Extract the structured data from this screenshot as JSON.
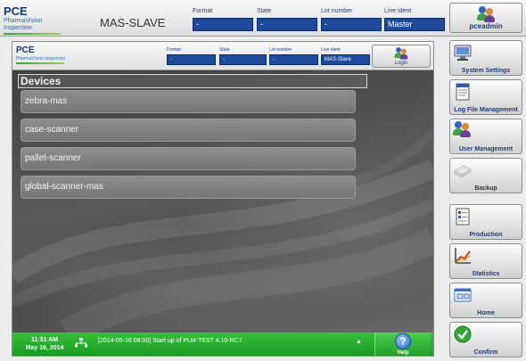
{
  "header": {
    "brand": "PCE",
    "brand_sub": "PharmaVision Inspection",
    "title": "MAS-SLAVE",
    "fields": [
      {
        "label": "Format",
        "value": "-"
      },
      {
        "label": "State",
        "value": "-"
      },
      {
        "label": "Lot number",
        "value": "-"
      },
      {
        "label": "Line ident",
        "value": "Master"
      }
    ],
    "user_button_label": "pceadmin"
  },
  "panel": {
    "header": {
      "brand": "PCE",
      "brand_sub": "PharmaVision Inspection",
      "fields": [
        {
          "label": "Format",
          "value": "-"
        },
        {
          "label": "State",
          "value": "-"
        },
        {
          "label": "Lot number",
          "value": "-"
        },
        {
          "label": "Line ident",
          "value": "MAS-Slave"
        }
      ],
      "login_label": "Login"
    },
    "devices_title": "Devices",
    "devices": [
      "zebra-mas",
      "case-scanner",
      "pallet-scanner",
      "global-scanner-mas"
    ],
    "status": {
      "time": "11:31 AM",
      "date": "May 16, 2014",
      "message": "[2014-05-16 08:00] Start up of PLM-TEST 4.10-RC7",
      "expand_glyph": "▲",
      "help_label": "Help",
      "help_glyph": "?"
    }
  },
  "sidebar": {
    "items": [
      {
        "label": "System Settings",
        "icon": "monitor-icon",
        "enabled": true
      },
      {
        "label": "Log File Management",
        "icon": "log-file-icon",
        "enabled": true
      },
      {
        "label": "User Management",
        "icon": "users-icon",
        "enabled": true
      },
      {
        "label": "Backup",
        "icon": "backup-icon",
        "enabled": false
      },
      {
        "label": "Production",
        "icon": "production-icon",
        "enabled": true
      },
      {
        "label": "Statistics",
        "icon": "statistics-icon",
        "enabled": true
      },
      {
        "label": "Home",
        "icon": "home-icon",
        "enabled": true
      },
      {
        "label": "Confirm",
        "icon": "confirm-icon",
        "enabled": true
      }
    ]
  },
  "colors": {
    "field_blue": "#1f4a9b",
    "status_green": "#22a52a",
    "label_blue": "#1e3d7a"
  }
}
